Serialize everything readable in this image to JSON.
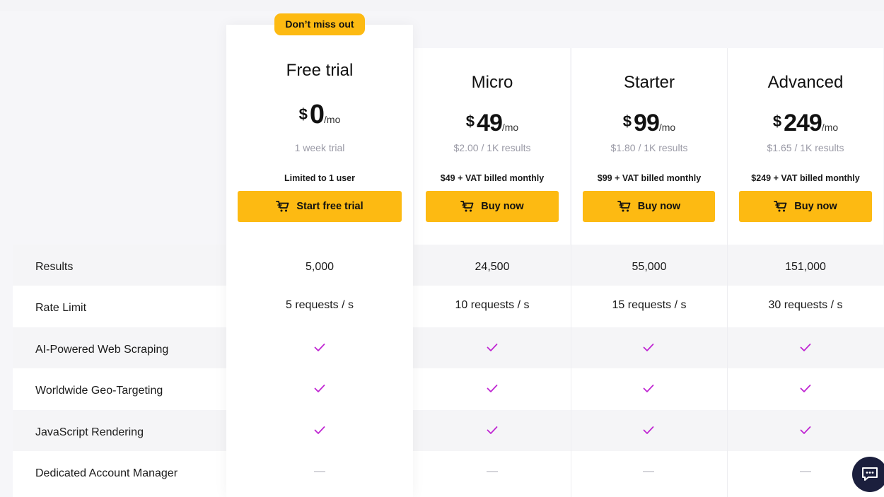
{
  "badge": "Don’t miss out",
  "plans": {
    "free": {
      "name": "Free trial",
      "currency": "$",
      "amount": "0",
      "period": "/mo",
      "sub": "1 week trial",
      "billing": "Limited to 1 user",
      "button": "Start free trial"
    },
    "micro": {
      "name": "Micro",
      "currency": "$",
      "amount": "49",
      "period": "/mo",
      "sub": "$2.00 / 1K results",
      "billing": "$49 + VAT billed monthly",
      "button": "Buy now"
    },
    "starter": {
      "name": "Starter",
      "currency": "$",
      "amount": "99",
      "period": "/mo",
      "sub": "$1.80 / 1K results",
      "billing": "$99 + VAT billed monthly",
      "button": "Buy now"
    },
    "advanced": {
      "name": "Advanced",
      "currency": "$",
      "amount": "249",
      "period": "/mo",
      "sub": "$1.65 / 1K results",
      "billing": "$249 + VAT billed monthly",
      "button": "Buy now"
    }
  },
  "features": {
    "results": {
      "label": "Results",
      "values": [
        "5,000",
        "24,500",
        "55,000",
        "151,000"
      ]
    },
    "rate_limit": {
      "label": "Rate Limit",
      "values": [
        "5 requests / s",
        "10 requests / s",
        "15 requests / s",
        "30 requests / s"
      ]
    },
    "ai_scraping": {
      "label": "AI-Powered Web Scraping",
      "included": [
        true,
        true,
        true,
        true
      ]
    },
    "geo_targeting": {
      "label": "Worldwide Geo-Targeting",
      "included": [
        true,
        true,
        true,
        true
      ]
    },
    "js_rendering": {
      "label": "JavaScript Rendering",
      "included": [
        true,
        true,
        true,
        true
      ]
    },
    "account_manager": {
      "label": "Dedicated Account Manager",
      "included": [
        false,
        false,
        false,
        false
      ]
    }
  },
  "colors": {
    "accent": "#fdba12",
    "check": "#c026d3",
    "chat_bg": "#1b1f3d"
  },
  "icons": {
    "button": "cart-icon",
    "check": "checkmark-icon",
    "dash": "dash-icon",
    "chat": "chat-icon"
  }
}
